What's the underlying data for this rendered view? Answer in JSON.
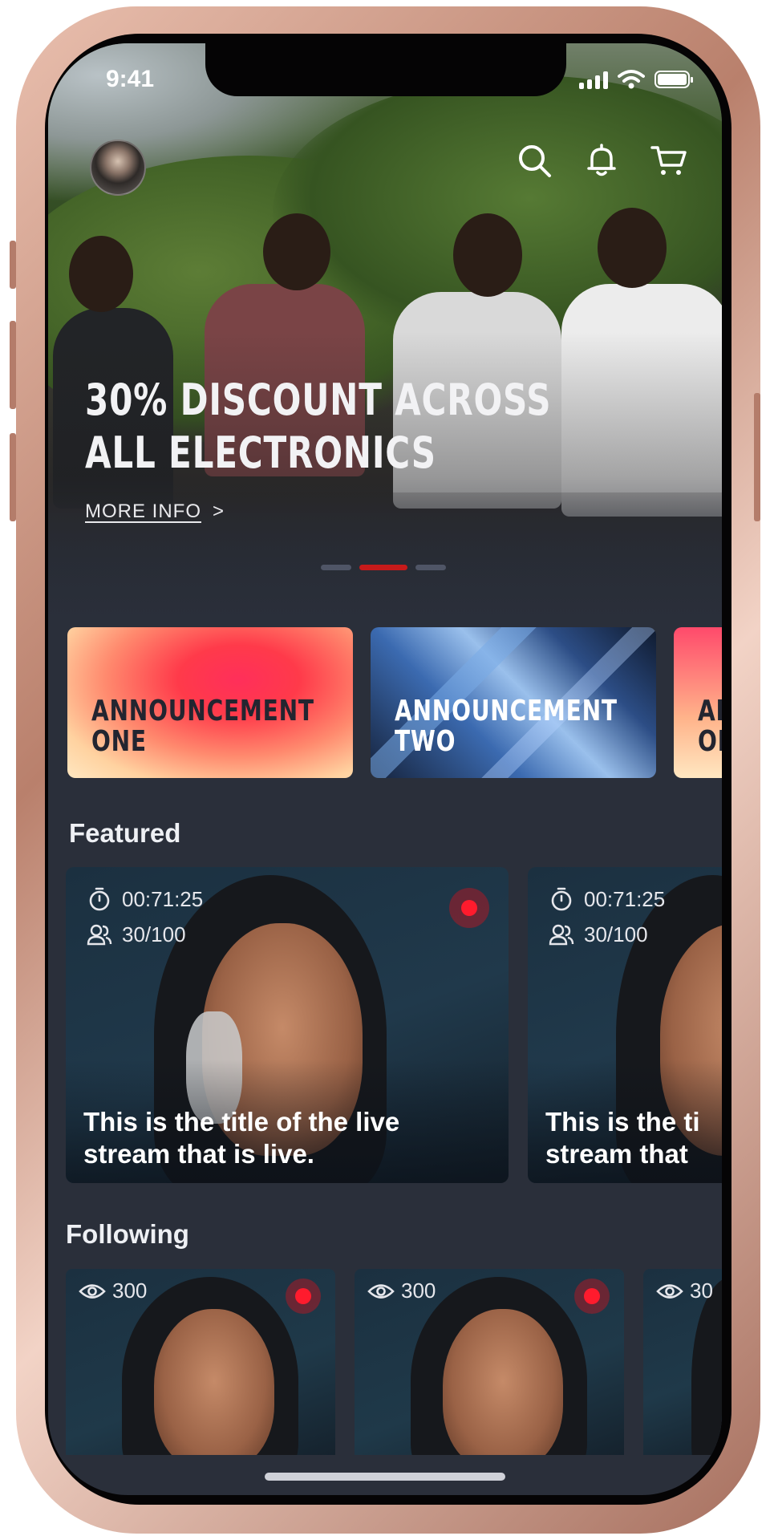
{
  "status_bar": {
    "time": "9:41"
  },
  "header": {
    "actions": [
      {
        "icon": "search-icon"
      },
      {
        "icon": "bell-icon"
      },
      {
        "icon": "cart-icon"
      }
    ]
  },
  "hero": {
    "title_line1": "30% DISCOUNT ACROSS",
    "title_line2": "ALL ELECTRONICS",
    "link_label": "MORE INFO",
    "link_chevron": ">",
    "pager": {
      "count": 3,
      "active_index": 1
    }
  },
  "announcements": [
    {
      "line1": "ANNOUNCEMENT",
      "line2": "ONE"
    },
    {
      "line1": "ANNOUNCEMENT",
      "line2": "TWO"
    },
    {
      "line1": "AN",
      "line2": "ON"
    }
  ],
  "featured": {
    "title": "Featured",
    "cards": [
      {
        "timer": "00:71:25",
        "participants": "30/100",
        "title": "This is the title of the live stream that is live.",
        "live": true
      },
      {
        "timer": "00:71:25",
        "participants": "30/100",
        "title": "This is the ti stream that",
        "live": false
      }
    ]
  },
  "following": {
    "title": "Following",
    "cards": [
      {
        "views": "300",
        "live": true
      },
      {
        "views": "300",
        "live": true
      },
      {
        "views": "30",
        "live": false
      }
    ]
  },
  "colors": {
    "background": "#2a2f3a",
    "accent": "#c61a1a",
    "live_red": "#ff1b2d"
  }
}
